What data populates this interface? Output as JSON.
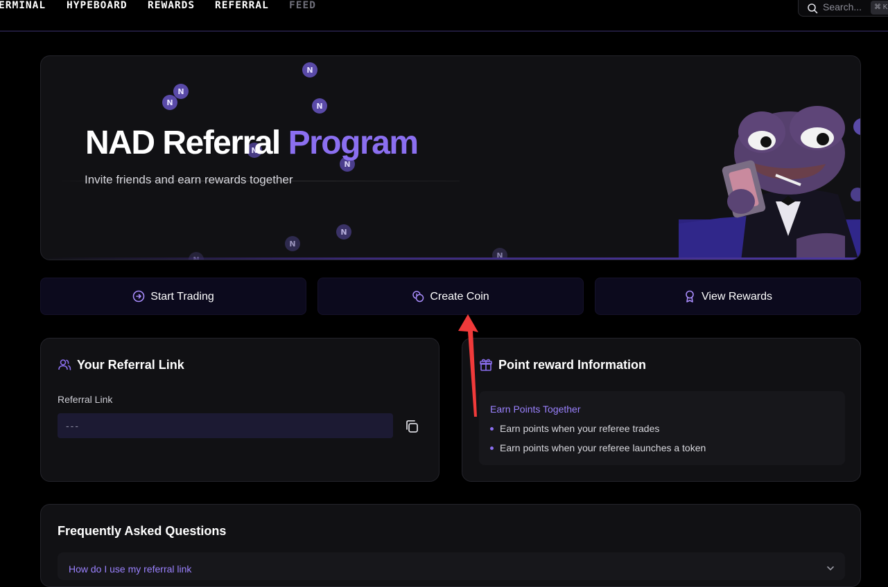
{
  "nav": {
    "items": [
      {
        "label": "ERMINAL"
      },
      {
        "label": "HYPEBOARD"
      },
      {
        "label": "REWARDS"
      },
      {
        "label": "REFERRAL"
      },
      {
        "label": "FEED"
      }
    ],
    "search_placeholder": "Search...",
    "search_shortcut": "⌘ K"
  },
  "hero": {
    "title_main": "NAD Referral",
    "title_accent": "Program",
    "subtitle": "Invite friends and earn rewards together",
    "coin_glyph": "N"
  },
  "actions": [
    {
      "label": "Start Trading",
      "icon": "arrow-right-circle-icon"
    },
    {
      "label": "Create Coin",
      "icon": "coins-icon"
    },
    {
      "label": "View Rewards",
      "icon": "award-icon"
    }
  ],
  "referral_card": {
    "title": "Your Referral Link",
    "field_label": "Referral Link",
    "link_value": "---",
    "icon": "users-icon"
  },
  "reward_card": {
    "title": "Point reward Information",
    "icon": "gift-icon",
    "info_heading": "Earn Points Together",
    "bullets": [
      "Earn points when your referee trades",
      "Earn points when your referee launches a token"
    ]
  },
  "faq": {
    "title": "Frequently Asked Questions",
    "items": [
      {
        "question": "How do I use my referral link"
      }
    ]
  },
  "colors": {
    "accent": "#8b6ff0",
    "button_bg": "#0c0a1d",
    "card_bg": "#111114",
    "annotation_arrow": "#f03a3a"
  }
}
